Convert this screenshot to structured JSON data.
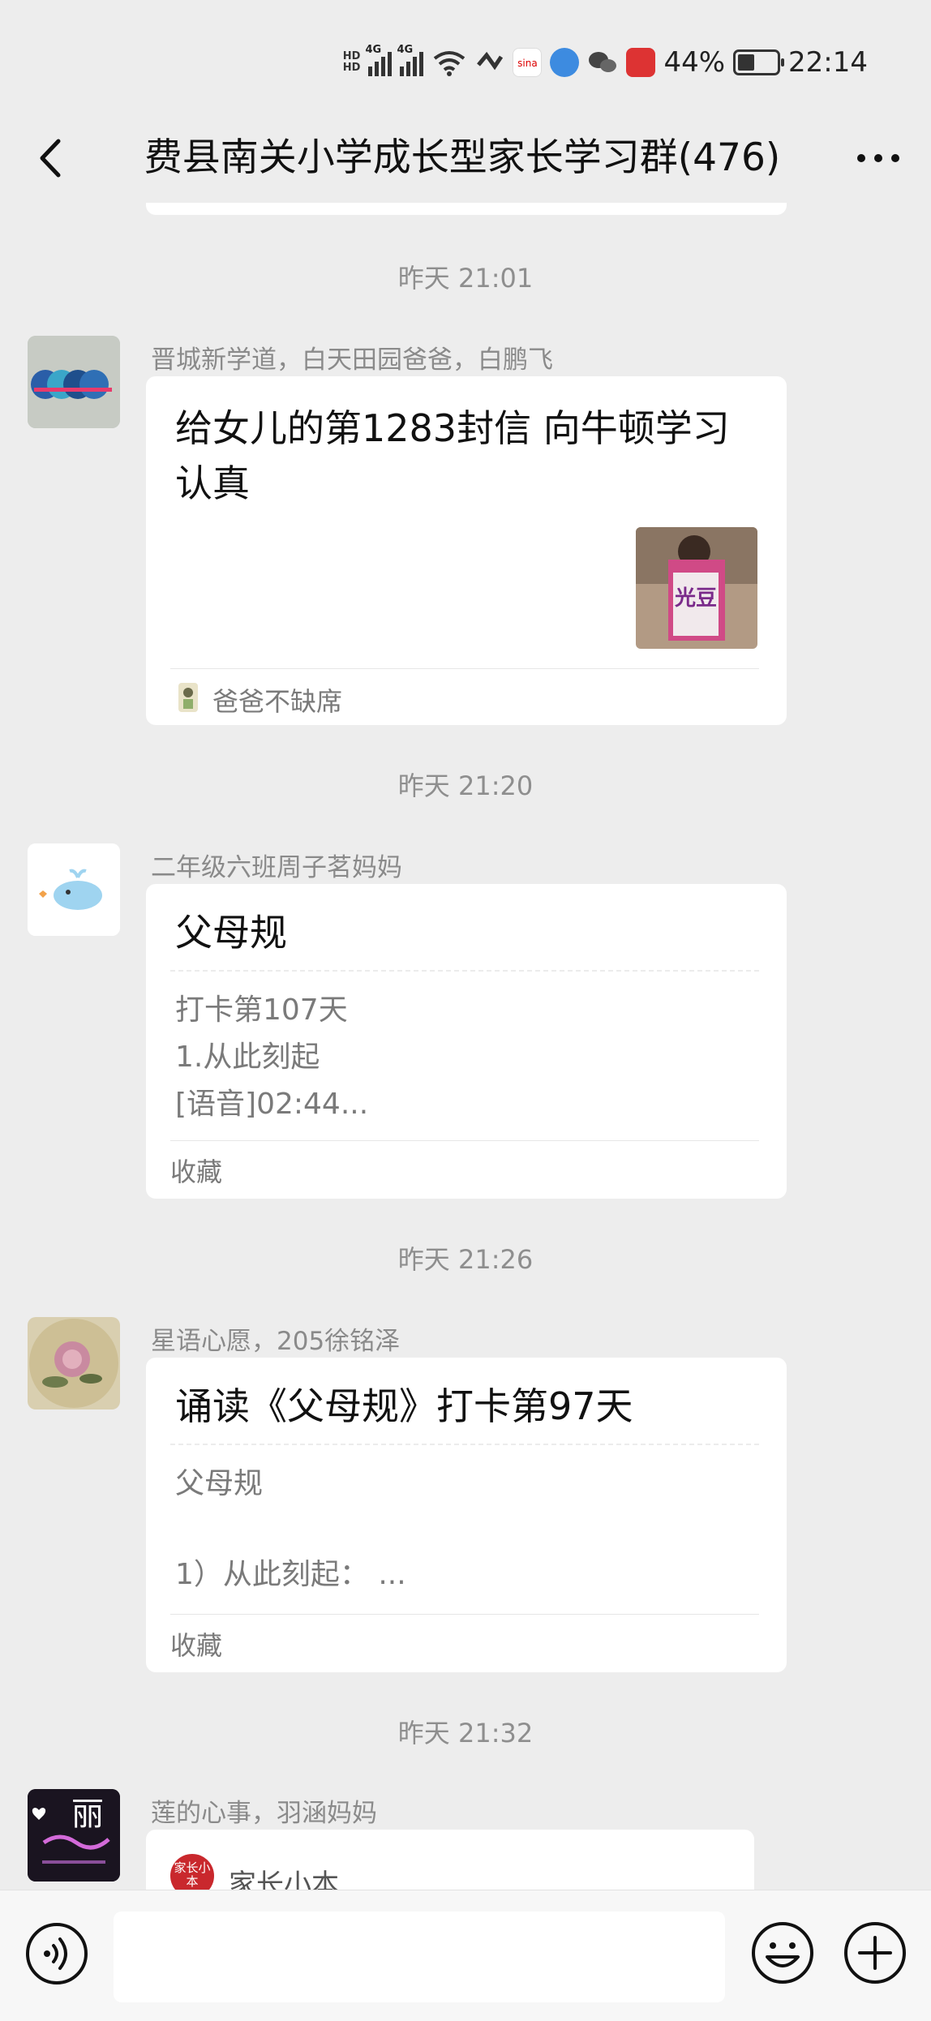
{
  "status_bar": {
    "network_1": "4G",
    "network_2": "4G",
    "wifi_label": "6",
    "battery_percent": "44%",
    "time": "22:14"
  },
  "nav": {
    "title": "费县南关小学成长型家长学习群(476)"
  },
  "messages": [
    {
      "timestamp": "昨天 21:01",
      "sender": "晋城新学道，白天田园爸爸，白鹏飞",
      "title": "给女儿的第1283封信 向牛顿学习认真",
      "image_text": "光豆",
      "footer": "爸爸不缺席"
    },
    {
      "timestamp": "昨天 21:20",
      "sender": "二年级六班周子茗妈妈",
      "title": "父母规",
      "lines": [
        "打卡第107天",
        "1.从此刻起",
        "[语音]02:44..."
      ],
      "footer": "收藏"
    },
    {
      "timestamp": "昨天 21:26",
      "sender": "星语心愿，205徐铭泽",
      "title": "诵读《父母规》打卡第97天",
      "lines": [
        "父母规",
        "",
        "1）从此刻起：  ..."
      ],
      "footer": "收藏"
    },
    {
      "timestamp": "昨天 21:32",
      "sender": "莲的心事，羽涵妈妈",
      "avatar_text": "丽",
      "mini_app_badge": "家长小本",
      "mini_app_name": "家长小本"
    }
  ],
  "colors": {
    "background": "#ededed",
    "card": "#ffffff",
    "meta_text": "#8e8e8e"
  }
}
